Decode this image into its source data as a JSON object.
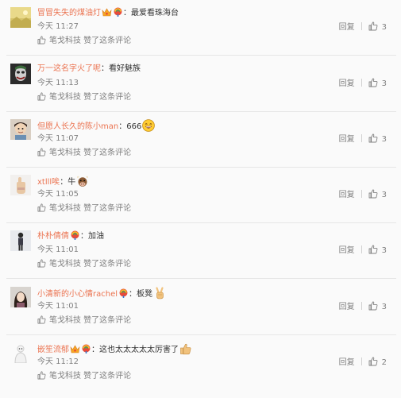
{
  "comments": [
    {
      "username": "冒冒失失的煤油灯",
      "badges": [
        "vip-crown-badge",
        "rainbow-badge"
      ],
      "text": "最爱看珠海台",
      "emoji": "",
      "time": "今天 11:27",
      "liked_by": "笔戈科技 赞了这条评论",
      "reply_label": "回复",
      "like_count": "3",
      "avatar": "yellow-landscape"
    },
    {
      "username": "万一这名字火了呢",
      "badges": [],
      "text": "看好魅族",
      "emoji": "",
      "time": "今天 11:13",
      "liked_by": "笔戈科技 赞了这条评论",
      "reply_label": "回复",
      "like_count": "3",
      "avatar": "dark-joker"
    },
    {
      "username": "但愿人长久的陈小man",
      "badges": [],
      "text": "666",
      "emoji": "laughing-emoji",
      "time": "今天 11:07",
      "liked_by": "笔戈科技 赞了这条评论",
      "reply_label": "回复",
      "like_count": "3",
      "avatar": "person-face"
    },
    {
      "username": "xtlll唉",
      "badges": [],
      "text": "牛",
      "emoji": "cow-emoji",
      "time": "今天 11:05",
      "liked_by": "笔戈科技 赞了这条评论",
      "reply_label": "回复",
      "like_count": "3",
      "avatar": "hand"
    },
    {
      "username": "朴朴倩倩",
      "badges": [
        "rainbow-badge"
      ],
      "text": "加油",
      "emoji": "",
      "time": "今天 11:01",
      "liked_by": "笔戈科技 赞了这条评论",
      "reply_label": "回复",
      "like_count": "3",
      "avatar": "person-standing"
    },
    {
      "username": "小清新的小心情rachel",
      "badges": [
        "rainbow-badge"
      ],
      "text": "板凳",
      "emoji": "victory-hand-emoji",
      "time": "今天 11:01",
      "liked_by": "笔戈科技 赞了这条评论",
      "reply_label": "回复",
      "like_count": "3",
      "avatar": "girl"
    },
    {
      "username": "嵌笙流郁",
      "badges": [
        "vip-crown-badge",
        "rainbow-badge"
      ],
      "text": "这也太太太太太厉害了",
      "emoji": "thumbs-up-emoji",
      "time": "今天 11:12",
      "liked_by": "笔戈科技 赞了这条评论",
      "reply_label": "回复",
      "like_count": "2",
      "avatar": "white-figure"
    }
  ],
  "colors": {
    "username": "#eb7350",
    "meta": "#808080",
    "text": "#333333",
    "background": "#fafafa"
  }
}
